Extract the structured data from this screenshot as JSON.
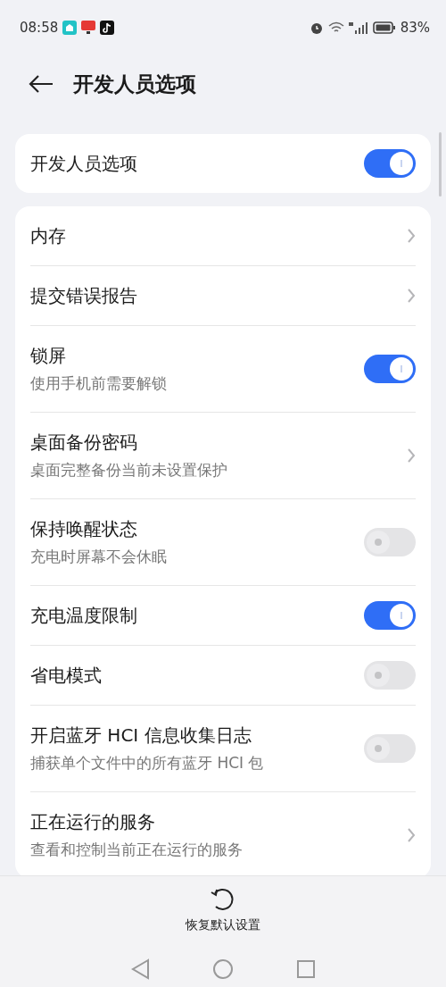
{
  "status_bar": {
    "time": "08:58",
    "battery": "83%"
  },
  "header": {
    "title": "开发人员选项"
  },
  "master": {
    "label": "开发人员选项",
    "on": true
  },
  "items": [
    {
      "kind": "chevron",
      "title": "内存"
    },
    {
      "kind": "chevron",
      "title": "提交错误报告"
    },
    {
      "kind": "toggle",
      "title": "锁屏",
      "subtitle": "使用手机前需要解锁",
      "on": true
    },
    {
      "kind": "chevron",
      "title": "桌面备份密码",
      "subtitle": "桌面完整备份当前未设置保护"
    },
    {
      "kind": "toggle",
      "title": "保持唤醒状态",
      "subtitle": "充电时屏幕不会休眠",
      "on": false
    },
    {
      "kind": "toggle",
      "title": "充电温度限制",
      "on": true
    },
    {
      "kind": "toggle",
      "title": "省电模式",
      "on": false
    },
    {
      "kind": "toggle",
      "title": "开启蓝牙 HCI 信息收集日志",
      "subtitle": "捕获单个文件中的所有蓝牙 HCI 包",
      "on": false
    },
    {
      "kind": "chevron",
      "title": "正在运行的服务",
      "subtitle": "查看和控制当前正在运行的服务"
    }
  ],
  "footer": {
    "action": "恢复默认设置"
  }
}
